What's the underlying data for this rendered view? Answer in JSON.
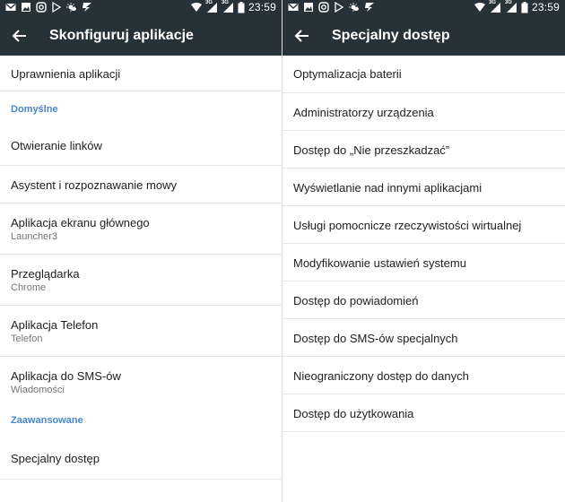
{
  "status": {
    "time": "23:59",
    "network": "3G"
  },
  "left": {
    "title": "Skonfiguruj aplikacje",
    "items": [
      {
        "title": "Uprawnienia aplikacji"
      },
      {
        "section": "Domyślne"
      },
      {
        "title": "Otwieranie linków"
      },
      {
        "title": "Asystent i rozpoznawanie mowy"
      },
      {
        "title": "Aplikacja ekranu głównego",
        "sub": "Launcher3"
      },
      {
        "title": "Przeglądarka",
        "sub": "Chrome"
      },
      {
        "title": "Aplikacja Telefon",
        "sub": "Telefon"
      },
      {
        "title": "Aplikacja do SMS-ów",
        "sub": "Wiadomości"
      },
      {
        "section": "Zaawansowane"
      },
      {
        "title": "Specjalny dostęp"
      }
    ]
  },
  "right": {
    "title": "Specjalny dostęp",
    "items": [
      {
        "title": "Optymalizacja baterii"
      },
      {
        "title": "Administratorzy urządzenia"
      },
      {
        "title": "Dostęp do „Nie przeszkadzać”"
      },
      {
        "title": "Wyświetlanie nad innymi aplikacjami"
      },
      {
        "title": "Usługi pomocnicze rzeczywistości wirtualnej"
      },
      {
        "title": "Modyfikowanie ustawień systemu"
      },
      {
        "title": "Dostęp do powiadomień"
      },
      {
        "title": "Dostęp do SMS-ów specjalnych"
      },
      {
        "title": "Nieograniczony dostęp do danych"
      },
      {
        "title": "Dostęp do użytkowania"
      }
    ]
  },
  "colors": {
    "toolbar": "#263238",
    "accent": "#4a86c8"
  }
}
